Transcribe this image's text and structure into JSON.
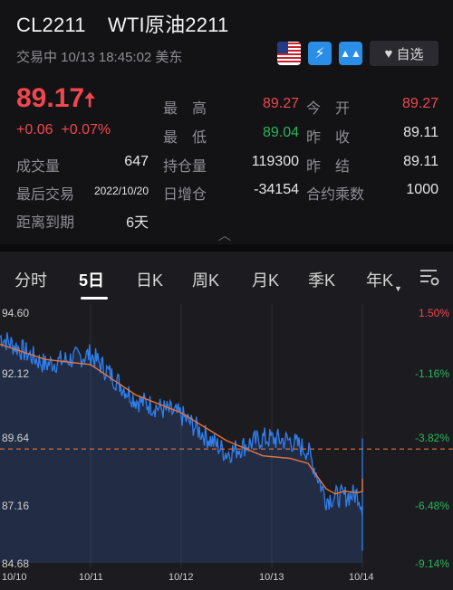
{
  "header": {
    "code": "CL2211",
    "name": "WTI原油2211",
    "status": "交易中 10/13 18:45:02 美东",
    "watch_label": "自选"
  },
  "quote": {
    "price": "89.17",
    "change": "+0.06",
    "change_pct": "+0.07%",
    "high_label": "最　高",
    "high": "89.27",
    "low_label": "最　低",
    "low": "89.04",
    "open_label": "今　开",
    "open": "89.27",
    "prev_close_label": "昨　收",
    "prev_close": "89.11",
    "volume_label": "成交量",
    "volume": "647",
    "open_interest_label": "持仓量",
    "open_interest": "119300",
    "prev_settle_label": "昨　结",
    "prev_settle": "89.11",
    "last_trade_label": "最后交易",
    "last_trade": "2022/10/20",
    "daily_oi_label": "日增仓",
    "daily_oi": "-34154",
    "multiplier_label": "合约乘数",
    "multiplier": "1000",
    "expiry_label": "距离到期",
    "expiry": "6天"
  },
  "tabs": [
    {
      "label": "分时"
    },
    {
      "label": "5日"
    },
    {
      "label": "日K"
    },
    {
      "label": "周K"
    },
    {
      "label": "月K"
    },
    {
      "label": "季K"
    },
    {
      "label": "年K"
    }
  ],
  "colors": {
    "up": "#f0474f",
    "down": "#26b55a",
    "line": "#2f7ff0",
    "avg": "#e8743b"
  },
  "chart_data": {
    "type": "line",
    "y_left_ticks": [
      "94.60",
      "92.12",
      "89.64",
      "87.16",
      "84.68"
    ],
    "y_right_ticks": [
      "1.50%",
      "-1.16%",
      "-3.82%",
      "-6.48%",
      "-9.14%"
    ],
    "x_ticks": [
      "10/10",
      "10/11",
      "10/12",
      "10/13",
      "10/14"
    ],
    "ylim": [
      84.68,
      94.6
    ],
    "reference_price": 89.11,
    "x": [
      0,
      0.5,
      1.0,
      1.5,
      2.0,
      2.5,
      2.9,
      3.2,
      3.4,
      3.6,
      3.7,
      3.8,
      3.95,
      4.0,
      4.08,
      4.15,
      4.2,
      4.25
    ],
    "price": [
      93.6,
      92.5,
      92.9,
      91.1,
      90.5,
      89.0,
      89.6,
      89.5,
      89.1,
      87.2,
      87.3,
      87.3,
      87.4,
      86.9,
      85.3,
      89.4,
      89.3,
      89.17
    ],
    "avg": [
      93.3,
      92.7,
      92.5,
      91.3,
      90.6,
      89.5,
      88.9,
      88.8,
      88.6,
      87.6,
      87.4,
      87.5,
      87.45,
      87.5,
      87.7,
      87.8,
      87.95,
      88.0
    ]
  }
}
